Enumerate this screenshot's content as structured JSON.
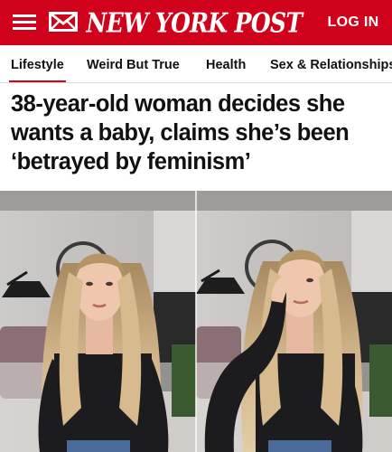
{
  "header": {
    "logo_text": "NEW YORK POST",
    "login_label": "LOG IN",
    "menu_icon": "hamburger-menu-icon",
    "mail_icon": "envelope-icon"
  },
  "nav": {
    "items": [
      {
        "label": "Lifestyle",
        "active": true
      },
      {
        "label": "Weird But True",
        "active": false
      },
      {
        "label": "Health",
        "active": false
      },
      {
        "label": "Sex & Relationships",
        "active": false
      }
    ]
  },
  "article": {
    "headline": "38-year-old woman decides she wants a baby, claims she’s been ‘betrayed by feminism’"
  },
  "colors": {
    "brand_red": "#d0021b",
    "text": "#111111"
  }
}
